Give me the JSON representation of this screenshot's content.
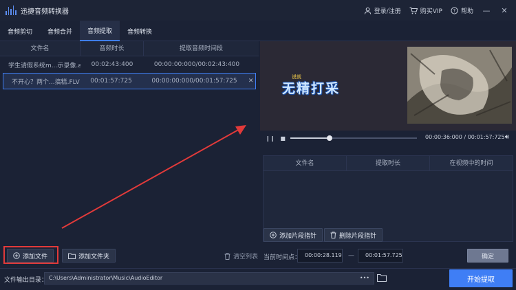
{
  "app": {
    "title": "迅捷音频转换器",
    "login": "登录/注册",
    "vip": "购买VIP",
    "help": "帮助",
    "brand_color": "#3f7ef5"
  },
  "tabs": [
    "音频剪切",
    "音频合并",
    "音频提取",
    "音频转换"
  ],
  "file_table": {
    "headers": [
      "文件名",
      "音频时长",
      "提取音频时间段"
    ],
    "rows": [
      {
        "name": "学生请假系统m...示录像.avi",
        "duration": "00:02:43:400",
        "range": "00:00:00:000/00:02:43:400",
        "close": ""
      },
      {
        "name": "不开心？两个...搞糕.FLV",
        "duration": "00:01:57:725",
        "range": "00:00:00:000/00:01:57:725",
        "close": "✕"
      }
    ]
  },
  "left_buttons": {
    "add_file": "添加文件",
    "add_folder": "添加文件夹",
    "clear_list": "清空列表"
  },
  "video": {
    "caption_small": "说就",
    "caption_main": "无精打采"
  },
  "player": {
    "current": "00:00:36:000",
    "separator": "/",
    "total": "00:01:57:725",
    "progress": 0.31
  },
  "clip_table": {
    "headers": [
      "文件名",
      "提取时长",
      "在视频中的时间"
    ]
  },
  "clip_buttons": {
    "add_pointer": "添加片段指针",
    "delete_pointer": "删除片段指针"
  },
  "current_time": {
    "label": "当前时间点：",
    "start": "00:00:28.119",
    "dash": "—",
    "end": "00:01:57.725",
    "confirm": "确定"
  },
  "output": {
    "label": "文件输出目录：",
    "path": "C:\\Users\\Administrator\\Music\\AudioEditor",
    "dots": "•••",
    "start_button": "开始提取"
  }
}
